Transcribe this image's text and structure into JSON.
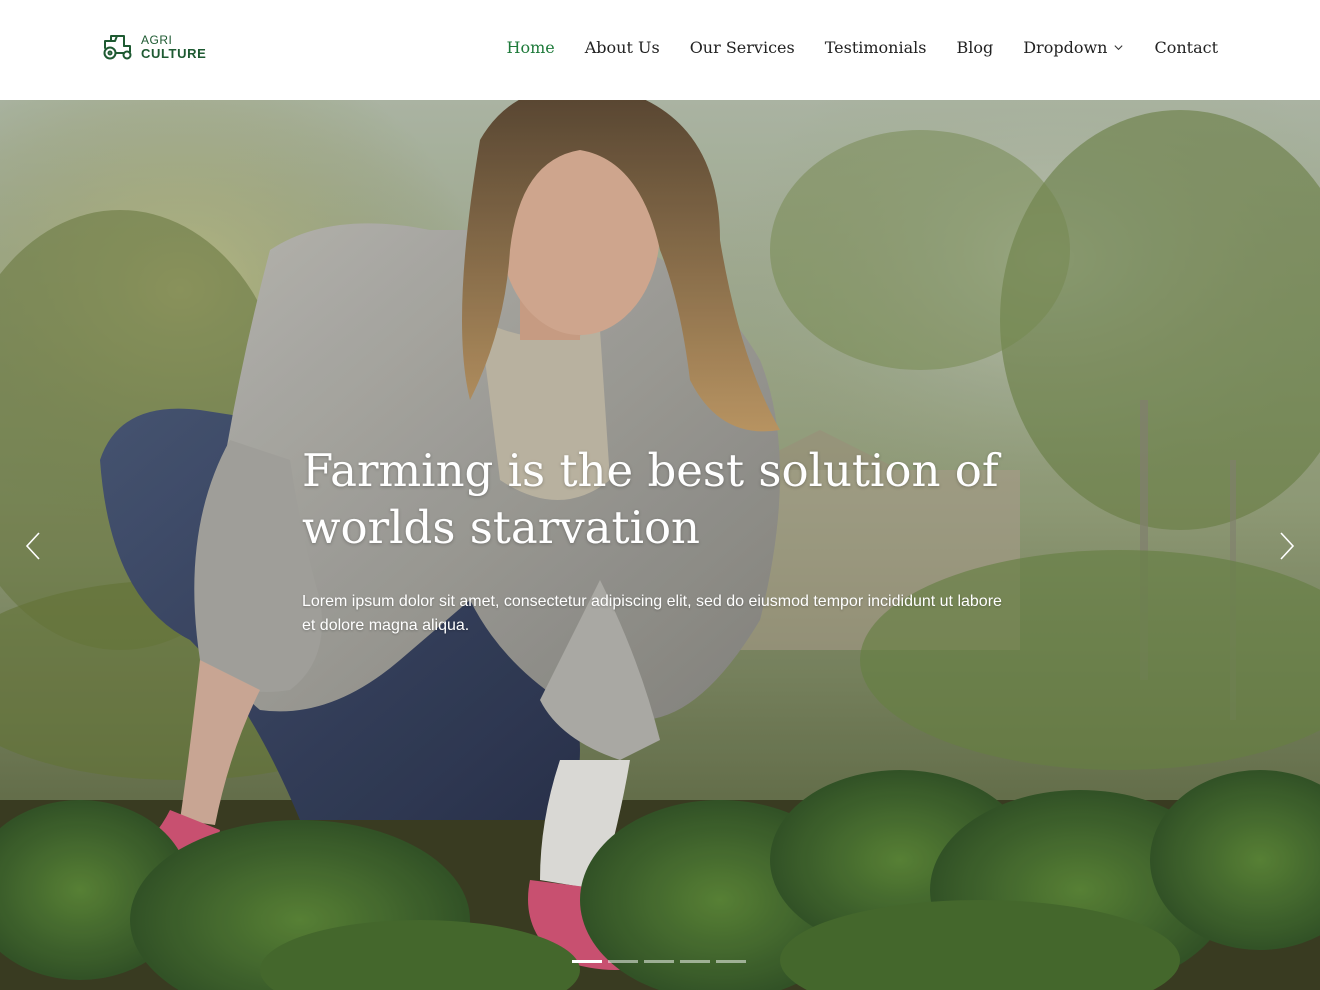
{
  "logo": {
    "line1": "AGRI",
    "line2": "CULTURE",
    "icon": "tractor-icon",
    "color": "#1e5a32"
  },
  "nav": {
    "items": [
      {
        "label": "Home",
        "active": true
      },
      {
        "label": "About Us"
      },
      {
        "label": "Our Services"
      },
      {
        "label": "Testimonials"
      },
      {
        "label": "Blog"
      },
      {
        "label": "Dropdown",
        "has_dropdown": true
      },
      {
        "label": "Contact"
      }
    ],
    "active_color": "#1e7a3a"
  },
  "hero": {
    "title": "Farming is the best solution of worlds starvation",
    "text": "Lorem ipsum dolor sit amet, consectetur adipiscing elit, sed do eiusmod tempor incididunt ut labore et dolore magna aliqua.",
    "image": "woman gardening among plants",
    "prev_icon": "chevron-left-icon",
    "next_icon": "chevron-right-icon"
  },
  "carousel": {
    "slide_count": 5,
    "active_index": 0
  }
}
